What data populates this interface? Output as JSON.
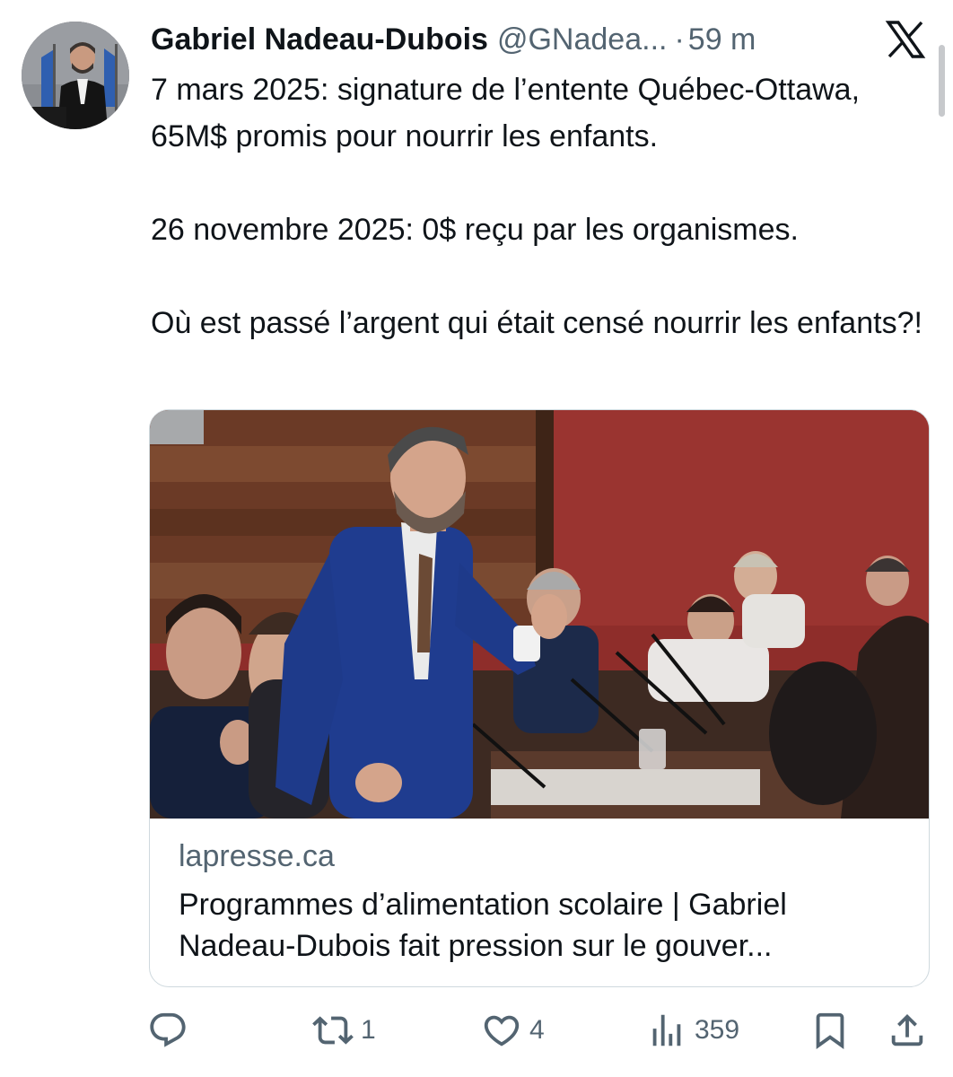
{
  "tweet": {
    "author_name": "Gabriel Nadeau-Dubois",
    "author_handle": "@GNadea...",
    "separator": "·",
    "time": "59 m",
    "text_lines": [
      "7 mars 2025: signature de l’entente Québec-Ottawa, 65M$ promis pour nourrir les enfants.",
      "26 novembre 2025: 0$ reçu par les organismes.",
      "Où est passé l’argent qui était censé nourrir les enfants?!"
    ]
  },
  "card": {
    "domain": "lapresse.ca",
    "title": "Programmes d’alimentation scolaire | Gabriel Nadeau-Dubois fait pression sur le gouver..."
  },
  "actions": {
    "reply": {
      "icon": "reply-icon",
      "count": ""
    },
    "retweet": {
      "icon": "retweet-icon",
      "count": "1"
    },
    "like": {
      "icon": "heart-icon",
      "count": "4"
    },
    "views": {
      "icon": "analytics-icon",
      "count": "359"
    },
    "bookmark": {
      "icon": "bookmark-icon",
      "count": ""
    },
    "share": {
      "icon": "share-icon",
      "count": ""
    }
  },
  "colors": {
    "text_primary": "#0f1419",
    "text_secondary": "#536471",
    "border": "#cfd9de",
    "chamber_red": "#8e2d2a",
    "suit_blue": "#1f3c8f"
  }
}
